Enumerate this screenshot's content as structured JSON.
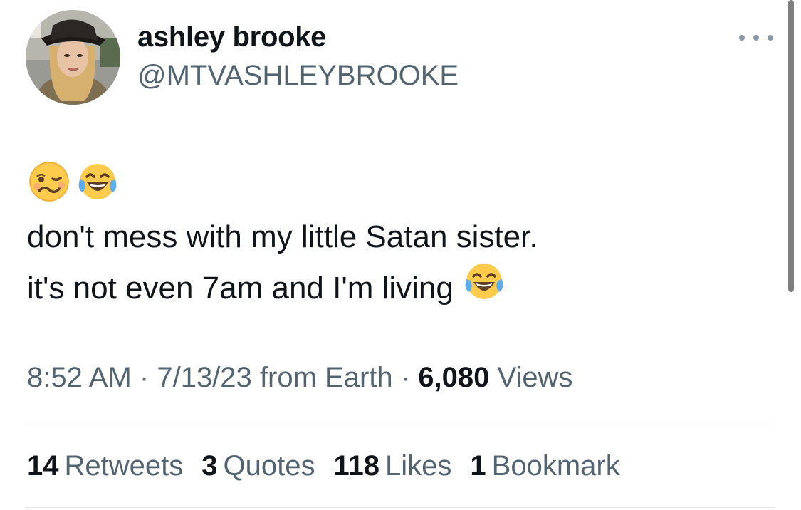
{
  "author": {
    "display_name": "ashley brooke",
    "handle": "@MTVASHLEYBROOKE",
    "avatar": "profile-photo"
  },
  "tweet": {
    "leading_emojis": [
      "woozy-face",
      "face-with-tears-of-joy"
    ],
    "lines": [
      "don't mess with my little Satan sister.",
      "it's not even 7am and I'm living"
    ],
    "trailing_emoji": "face-with-tears-of-joy"
  },
  "meta": {
    "time": "8:52 AM",
    "sep1": "·",
    "date": "7/13/23",
    "source": "from Earth",
    "sep2": "·",
    "views_count": "6,080",
    "views_label": "Views"
  },
  "stats": {
    "retweets": {
      "count": "14",
      "label": "Retweets"
    },
    "quotes": {
      "count": "3",
      "label": "Quotes"
    },
    "likes": {
      "count": "118",
      "label": "Likes"
    },
    "bookmarks": {
      "count": "1",
      "label": "Bookmark"
    }
  },
  "icons": {
    "more": "more-horizontal-icon"
  },
  "colors": {
    "text_primary": "#0f1419",
    "text_secondary": "#536471",
    "divider": "#dfe3e6",
    "emoji_yellow": "#ffcb4c",
    "tear_blue": "#5dadec"
  }
}
